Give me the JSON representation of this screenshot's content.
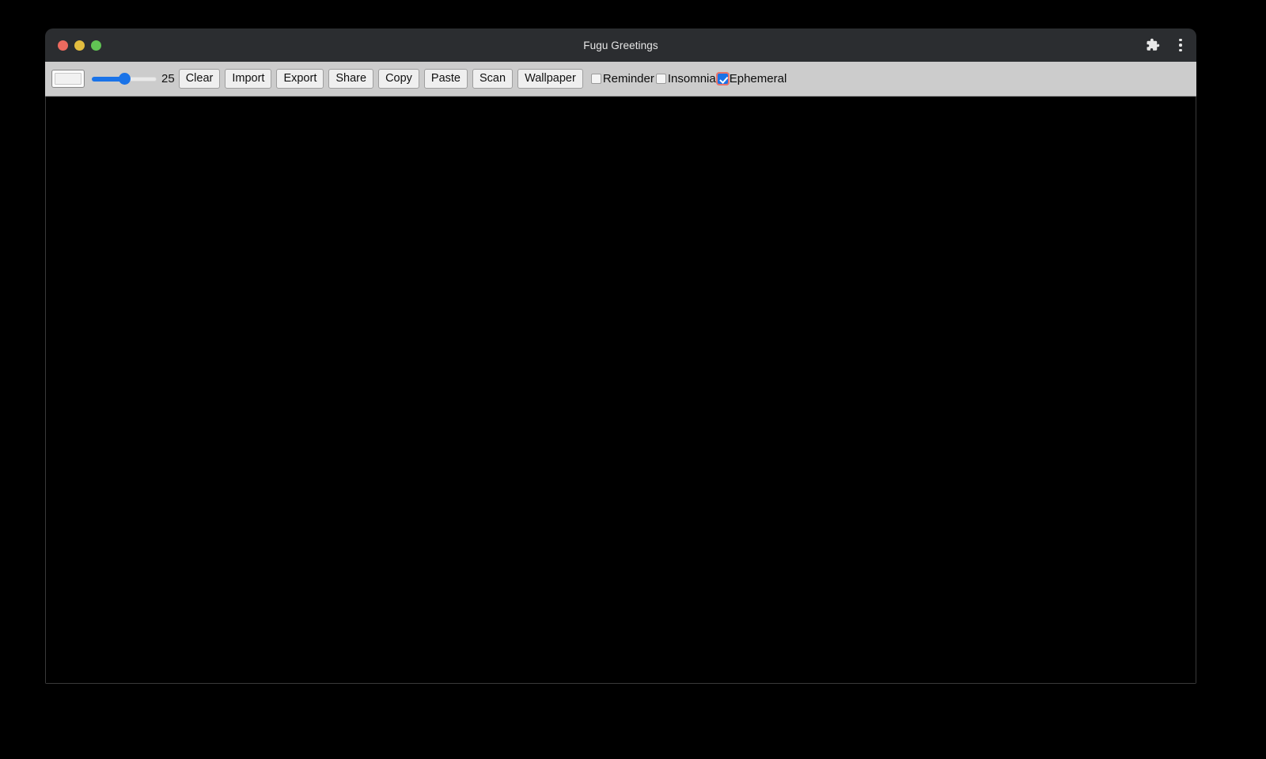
{
  "window": {
    "title": "Fugu Greetings",
    "traffic_lights": [
      {
        "name": "close",
        "color": "#ec6a5f"
      },
      {
        "name": "minimize",
        "color": "#e3bd3f"
      },
      {
        "name": "maximize",
        "color": "#61c554"
      }
    ],
    "titlebar_icons": [
      {
        "name": "extensions-icon",
        "glyph": "puzzle"
      },
      {
        "name": "more-menu-icon",
        "glyph": "three-dots"
      }
    ]
  },
  "toolbar": {
    "color_picker": {
      "label": "color-picker",
      "value": "#f1f1f1"
    },
    "line_width": {
      "label": "line-width",
      "value": "25",
      "min": "0",
      "max": "50",
      "percent": 50,
      "accent": "#1a73e8"
    },
    "buttons": [
      {
        "name": "clear-button",
        "label": "Clear"
      },
      {
        "name": "import-button",
        "label": "Import"
      },
      {
        "name": "export-button",
        "label": "Export"
      },
      {
        "name": "share-button",
        "label": "Share"
      },
      {
        "name": "copy-button",
        "label": "Copy"
      },
      {
        "name": "paste-button",
        "label": "Paste"
      },
      {
        "name": "scan-button",
        "label": "Scan"
      },
      {
        "name": "wallpaper-button",
        "label": "Wallpaper"
      }
    ],
    "checkboxes": [
      {
        "name": "reminder-checkbox",
        "label": "Reminder",
        "checked": false
      },
      {
        "name": "insomnia-checkbox",
        "label": "Insomnia",
        "checked": false
      },
      {
        "name": "ephemeral-checkbox",
        "label": "Ephemeral",
        "checked": true
      }
    ]
  },
  "canvas": {
    "name": "drawing-canvas",
    "background": "#000000"
  }
}
